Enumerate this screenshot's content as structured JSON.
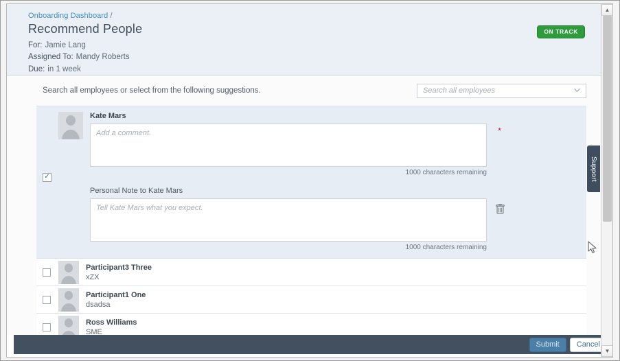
{
  "header": {
    "breadcrumb_link": "Onboarding Dashboard",
    "breadcrumb_separator": "/",
    "title": "Recommend People",
    "for_label": "For:",
    "for_value": "Jamie Lang",
    "assigned_label": "Assigned To:",
    "assigned_value": "Mandy Roberts",
    "due_label": "Due:",
    "due_value": "in 1 week",
    "status_badge": "ON TRACK",
    "status_color": "#2e9b3d"
  },
  "search": {
    "hint": "Search all employees or select from the following suggestions.",
    "placeholder": "Search all employees",
    "value": "",
    "chevron_icon": "chevron-down-icon"
  },
  "selected_person": {
    "checked": true,
    "name": "Kate Mars",
    "avatar_icon": "user-avatar-icon",
    "comment": {
      "placeholder": "Add a comment.",
      "value": "",
      "required_marker": "*",
      "char_count": "1000 characters remaining"
    },
    "note": {
      "label": "Personal Note to Kate Mars",
      "placeholder": "Tell Kate Mars what you expect.",
      "value": "",
      "char_count": "1000 characters remaining",
      "delete_icon": "trash-icon"
    }
  },
  "suggestions": [
    {
      "checked": false,
      "name": "Participant3 Three",
      "subtitle": "xZX",
      "avatar_icon": "user-avatar-icon"
    },
    {
      "checked": false,
      "name": "Participant1 One",
      "subtitle": "dsadsa",
      "avatar_icon": "user-avatar-icon"
    },
    {
      "checked": false,
      "name": "Ross Williams",
      "subtitle": "SME",
      "avatar_icon": "user-avatar-icon"
    }
  ],
  "footer": {
    "submit_label": "Submit",
    "cancel_label": "Cancel"
  },
  "support_tab": {
    "label": "Support"
  },
  "scrollbar": {
    "up_arrow": "▲",
    "down_arrow": "▼"
  }
}
